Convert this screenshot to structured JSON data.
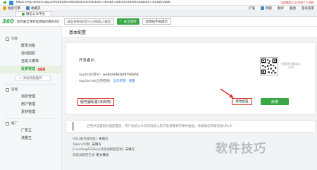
{
  "browser": {
    "url": "https://mp.weixin.qq.com/advanced/advanced?action=dev&t=advanced/dev&token=453561688",
    "extra": "当前微信公众号的个人资料"
  },
  "bookmarks": [
    "搜索引擎",
    "收藏夹",
    "扩展",
    "网银",
    "翻译",
    "截图",
    "登录管家"
  ],
  "tabs": [
    {
      "label": "微信公众平台",
      "active": true
    }
  ],
  "notice": {
    "logo": "360",
    "text": "您的安全保存此网站的密码吗？",
    "select": "(该信息将同时用于公共和私人使用)",
    "save_button": "安全保存",
    "no_save_button": "此网站不再提示"
  },
  "sidebar": {
    "groups": [
      {
        "label": "功能",
        "items": [
          "群发功能",
          "自动回复",
          "自定义菜单",
          "投票管理"
        ],
        "add": "添加功能插件"
      },
      {
        "label": "管理",
        "items": [
          "消息管理",
          "用户管理",
          "素材管理"
        ]
      },
      {
        "label": "推广",
        "items": [
          "广告主",
          "流量主"
        ]
      }
    ],
    "active_item": "投票管理",
    "badge": "NEW"
  },
  "main": {
    "title": "基本配置",
    "dev_section_title": "开发者ID",
    "app_id_label": "AppID(应用ID)",
    "app_id_value": "wx94ad9d2bf87b9266",
    "app_secret_label": "AppSecret(应用密钥)",
    "app_secret_link1": "显示密钥",
    "app_secret_link2": "重置",
    "qr_caption": "扫码关注测试公众号",
    "server_config_label": "服务器配置(未启用)",
    "modify_button": "修改配置",
    "enable_button": "启用",
    "info_text": "启用并设置服务器配置后，用户发给公众号的消息以及开发者需要的事件推送，将被微信转发到该URL中",
    "rows": [
      {
        "label": "URL(服务器地址)",
        "value": "未填写"
      },
      {
        "label": "Token(令牌)",
        "value": "未填写"
      },
      {
        "label": "EncodingAESKey(消息加解密密钥)",
        "value": "未填写"
      },
      {
        "label": "消息加解密方式",
        "value": "明文模式"
      }
    ]
  },
  "watermark": "软件技巧"
}
